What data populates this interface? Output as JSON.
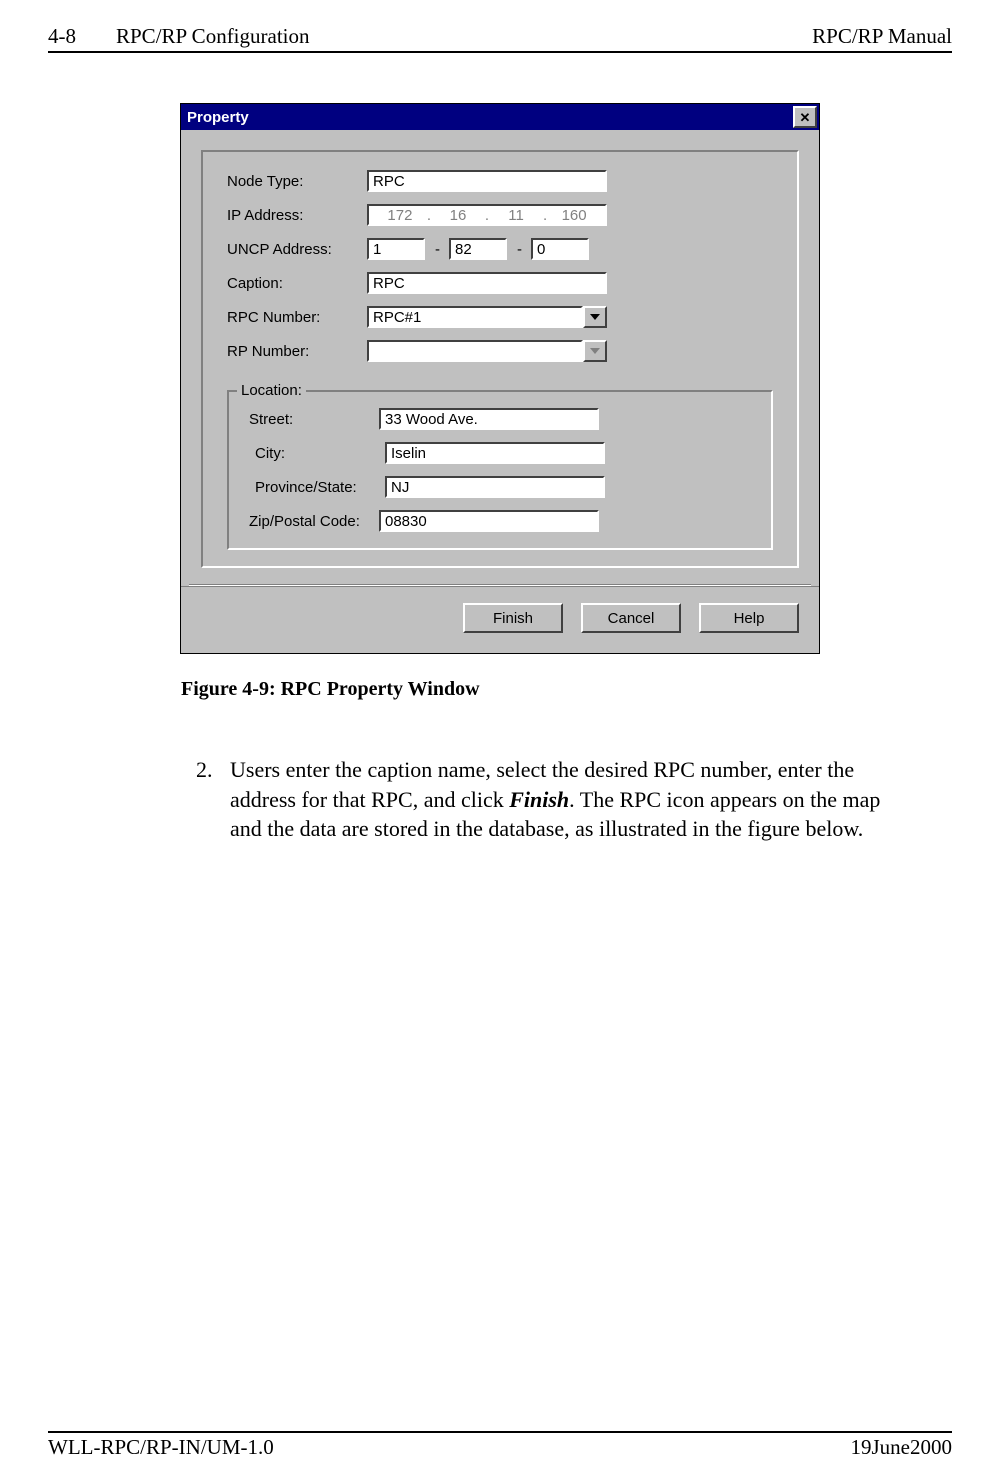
{
  "header": {
    "page_num": "4-8",
    "section": "RPC/RP Configuration",
    "doc_title": "RPC/RP Manual"
  },
  "dialog": {
    "title": "Property",
    "close_glyph": "✕",
    "fields": {
      "node_type": {
        "label": "Node Type:",
        "value": "RPC"
      },
      "ip_address": {
        "label": "IP Address:",
        "seg1": "172",
        "seg2": "16",
        "seg3": "11",
        "seg4": "160"
      },
      "uncp_address": {
        "label": "UNCP Address:",
        "seg1": "1",
        "seg2": "82",
        "seg3": "0"
      },
      "caption": {
        "label": "Caption:",
        "value": "RPC"
      },
      "rpc_number": {
        "label": "RPC Number:",
        "value": "RPC#1"
      },
      "rp_number": {
        "label": "RP Number:",
        "value": ""
      }
    },
    "location": {
      "legend": "Location:",
      "street": {
        "label": "Street:",
        "value": "33 Wood Ave."
      },
      "city": {
        "label": "City:",
        "value": "Iselin"
      },
      "province": {
        "label": "Province/State:",
        "value": "NJ"
      },
      "zip": {
        "label": "Zip/Postal Code:",
        "value": "08830"
      }
    },
    "buttons": {
      "finish": "Finish",
      "cancel": "Cancel",
      "help": "Help"
    }
  },
  "figure_caption": "Figure 4-9: RPC Property Window",
  "list_item": {
    "num": "2.",
    "text_parts": {
      "a": "Users enter the caption name, select the desired RPC number, enter the address for that RPC, and click ",
      "b": "Finish",
      "c": ".  The RPC icon appears on the map and the data are stored in the database, as illustrated in the figure below."
    }
  },
  "footer": {
    "left": "WLL-RPC/RP-IN/UM-1.0",
    "right": "19June2000"
  }
}
